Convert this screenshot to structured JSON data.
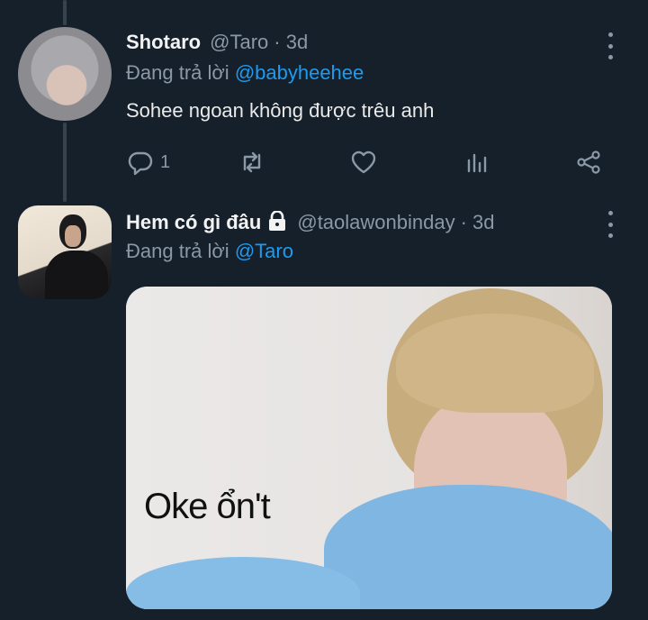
{
  "tweets": [
    {
      "display_name": "Shotaro",
      "handle": "@Taro",
      "time": "· 3d",
      "reply_prefix": "Đang trả lời ",
      "reply_to": "@babyheehee",
      "text": "Sohee ngoan không được trêu anh",
      "reply_count": "1"
    },
    {
      "display_name": "Hem có gì đâu",
      "handle": "@taolawonbinday",
      "time": "· 3d",
      "reply_prefix": "Đang trả lời ",
      "reply_to": "@Taro",
      "media_caption": "Oke ổn't"
    }
  ],
  "icons": {
    "reply": "speech-bubble",
    "retweet": "arrows-loop",
    "like": "heart",
    "analytics": "bar-chart",
    "share": "share-nodes",
    "more": "vertical-dots",
    "protected": "lock"
  },
  "colors": {
    "background": "#15202b",
    "mention": "#1d9bf0",
    "muted": "#8b98a5"
  }
}
